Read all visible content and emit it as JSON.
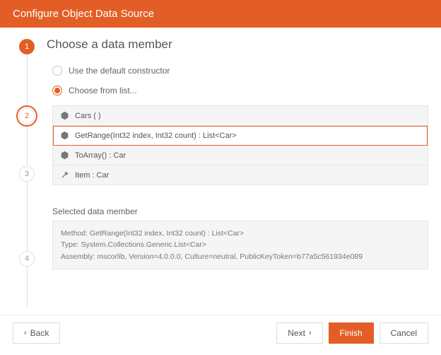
{
  "header": {
    "title": "Configure Object Data Source"
  },
  "steps": [
    "1",
    "2",
    "3",
    "4"
  ],
  "content": {
    "title": "Choose a data member",
    "option_default": "Use the default constructor",
    "option_list": "Choose from list...",
    "list": [
      {
        "label": "Cars ( )",
        "icon": "method"
      },
      {
        "label": "GetRange(Int32 index, Int32 count) : List<Car>",
        "icon": "method"
      },
      {
        "label": "ToArray() : Car",
        "icon": "method"
      },
      {
        "label": "Item : Car",
        "icon": "wrench"
      }
    ],
    "selected_header": "Selected data member",
    "selected_detail_1": "Method: GetRange(Int32 index, Int32 count) : List<Car>",
    "selected_detail_2": "Type: System.Collections.Generic.List<Car>",
    "selected_detail_3": "Assembly: mscorlib, Version=4.0.0.0, Culture=neutral, PublicKeyToken=b77a5c561934e089"
  },
  "footer": {
    "back": "Back",
    "next": "Next",
    "finish": "Finish",
    "cancel": "Cancel"
  }
}
